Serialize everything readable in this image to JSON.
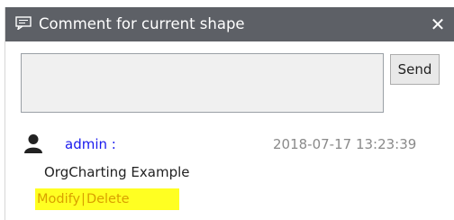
{
  "window": {
    "title": "Comment for current shape",
    "close_label": "✕"
  },
  "composer": {
    "input_value": "",
    "send_label": "Send"
  },
  "comments": [
    {
      "user": "admin :",
      "time": "2018-07-17 13:23:39",
      "text": "OrgCharting Example",
      "modify_label": "Modify",
      "separator": "|",
      "delete_label": "Delete"
    }
  ],
  "colors": {
    "titlebar": "#5d6066",
    "user_name": "#1a1aee",
    "timestamp": "#8a8a8a",
    "action_highlight": "#ffff22",
    "action_text": "#d9a000"
  },
  "icons": {
    "title": "comment-bubble-icon",
    "user": "user-icon"
  }
}
